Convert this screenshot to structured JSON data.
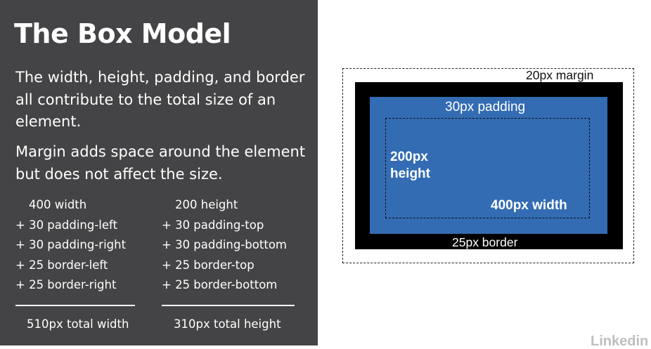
{
  "slide": {
    "title": "The Box Model",
    "paragraph1": "The width, height, padding, and border all contribute to the total size of an element.",
    "paragraph2": "Margin adds space around the element but does not affect the size."
  },
  "width_calc": {
    "lines": [
      "400 width",
      "+ 30 padding-left",
      "+ 30 padding-right",
      "+ 25 border-left",
      "+ 25 border-right"
    ],
    "total": "510px total width"
  },
  "height_calc": {
    "lines": [
      "200 height",
      "+ 30 padding-top",
      "+ 30 padding-bottom",
      "+ 25 border-top",
      "+ 25 border-bottom"
    ],
    "total": "310px total height"
  },
  "diagram": {
    "margin_label": "20px margin",
    "padding_label": "30px padding",
    "height_label": "200px height",
    "width_label": "400px width",
    "border_label": "25px border"
  },
  "watermark": "Linkedin",
  "colors": {
    "panel_background": "#444446",
    "padding_fill": "#336cb3",
    "border_fill": "#000000"
  }
}
